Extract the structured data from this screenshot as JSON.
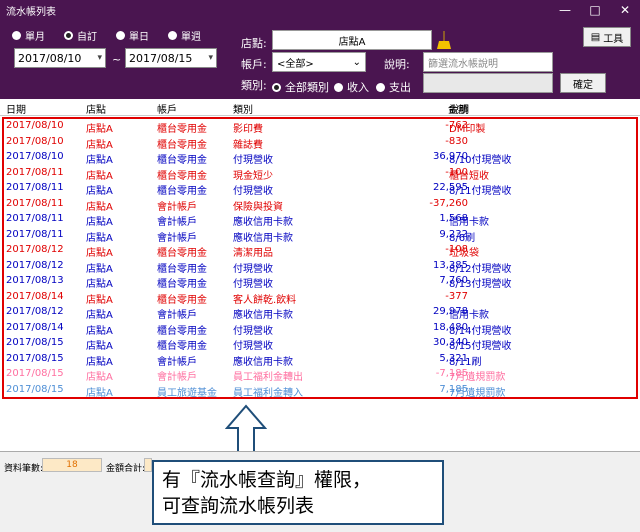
{
  "window": {
    "title": "流水帳列表",
    "min": "—",
    "max": "□",
    "close": "✕"
  },
  "filters": {
    "periods": [
      "單月",
      "自訂",
      "單日",
      "單週"
    ],
    "selected_period": "自訂",
    "date_from": "2017/08/10",
    "date_to": "2017/08/15",
    "date_sep": "~",
    "store_label": "店點:",
    "store_value": "店點A",
    "account_label": "帳戶:",
    "account_value": "<全部>",
    "note_label": "說明:",
    "note_placeholder": "篩選流水帳說明",
    "category_label": "類別:",
    "category_options": [
      "全部類別",
      "收入",
      "支出"
    ],
    "selected_category": "全部類別",
    "tools_button": "工具",
    "confirm_button": "確定"
  },
  "grid": {
    "headers": {
      "date": "日期",
      "store": "店點",
      "account": "帳戶",
      "category": "類別",
      "amount": "金額",
      "note": "說明"
    },
    "rows": [
      {
        "date": "2017/08/10",
        "store": "店點A",
        "account": "櫃台零用金",
        "category": "影印費",
        "amount": "-763",
        "note": "DM印製",
        "color": "#e00000"
      },
      {
        "date": "2017/08/10",
        "store": "店點A",
        "account": "櫃台零用金",
        "category": "雜誌費",
        "amount": "-830",
        "note": "",
        "color": "#e00000"
      },
      {
        "date": "2017/08/10",
        "store": "店點A",
        "account": "櫃台零用金",
        "category": "付現營收",
        "amount": "36,970",
        "note": "8/10付現營收",
        "color": "#0000c0"
      },
      {
        "date": "2017/08/11",
        "store": "店點A",
        "account": "櫃台零用金",
        "category": "現金短少",
        "amount": "-100",
        "note": "櫃台短收",
        "color": "#e00000"
      },
      {
        "date": "2017/08/11",
        "store": "店點A",
        "account": "櫃台零用金",
        "category": "付現營收",
        "amount": "22,595",
        "note": "8/11付現營收",
        "color": "#0000c0"
      },
      {
        "date": "2017/08/11",
        "store": "店點A",
        "account": "會計帳戶",
        "category": "保險與投資",
        "amount": "-37,260",
        "note": "",
        "color": "#e00000"
      },
      {
        "date": "2017/08/11",
        "store": "店點A",
        "account": "會計帳戶",
        "category": "應收信用卡款",
        "amount": "1,568",
        "note": "信用卡款",
        "color": "#0000c0"
      },
      {
        "date": "2017/08/11",
        "store": "店點A",
        "account": "會計帳戶",
        "category": "應收信用卡款",
        "amount": "9,232",
        "note": "8/6刷",
        "color": "#0000c0"
      },
      {
        "date": "2017/08/12",
        "store": "店點A",
        "account": "櫃台零用金",
        "category": "清潔用品",
        "amount": "-108",
        "note": "垃圾袋",
        "color": "#e00000"
      },
      {
        "date": "2017/08/12",
        "store": "店點A",
        "account": "櫃台零用金",
        "category": "付現營收",
        "amount": "13,385",
        "note": "8/12付現營收",
        "color": "#0000c0"
      },
      {
        "date": "2017/08/13",
        "store": "店點A",
        "account": "櫃台零用金",
        "category": "付現營收",
        "amount": "7,760",
        "note": "8/13付現營收",
        "color": "#0000c0"
      },
      {
        "date": "2017/08/14",
        "store": "店點A",
        "account": "櫃台零用金",
        "category": "客人餅乾.飲料",
        "amount": "-377",
        "note": "",
        "color": "#e00000"
      },
      {
        "date": "2017/08/12",
        "store": "店點A",
        "account": "會計帳戶",
        "category": "應收信用卡款",
        "amount": "29,978",
        "note": "信用卡款",
        "color": "#0000c0"
      },
      {
        "date": "2017/08/14",
        "store": "店點A",
        "account": "櫃台零用金",
        "category": "付現營收",
        "amount": "18,480",
        "note": "8/14付現營收",
        "color": "#0000c0"
      },
      {
        "date": "2017/08/15",
        "store": "店點A",
        "account": "櫃台零用金",
        "category": "付現營收",
        "amount": "30,340",
        "note": "8/15付現營收",
        "color": "#0000c0"
      },
      {
        "date": "2017/08/15",
        "store": "店點A",
        "account": "會計帳戶",
        "category": "應收信用卡款",
        "amount": "5,321",
        "note": "8/11刷",
        "color": "#0000c0"
      },
      {
        "date": "2017/08/15",
        "store": "店點A",
        "account": "會計帳戶",
        "category": "員工福利金轉出",
        "amount": "-7,185",
        "note": "7月遺規罰款",
        "color": "#ff6fa0"
      },
      {
        "date": "2017/08/15",
        "store": "店點A",
        "account": "員工旅遊基金",
        "category": "員工福利金轉入",
        "amount": "7,185",
        "note": "7月遺規罰款",
        "color": "#4f8fd6"
      }
    ]
  },
  "status": {
    "count_label": "資料筆數:",
    "count_value": "18",
    "total_label": "金額合計:"
  },
  "callout": {
    "line1": "有『流水帳查詢』權限，",
    "line2": "可查詢流水帳列表"
  }
}
